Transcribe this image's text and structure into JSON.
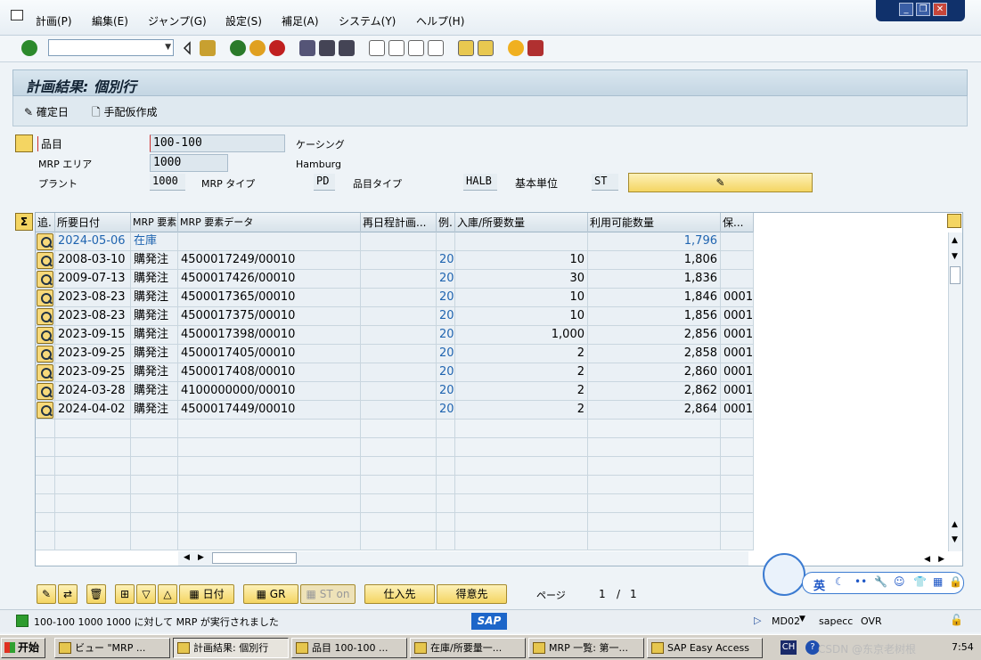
{
  "menubar": {
    "items": [
      "計画(P)",
      "編集(E)",
      "ジャンプ(G)",
      "設定(S)",
      "補足(A)",
      "システム(Y)",
      "ヘルプ(H)"
    ]
  },
  "toolbar": {
    "command_field_value": ""
  },
  "title": "計画結果: 個別行",
  "app_toolbar": {
    "firm_date": "確定日",
    "procurement": "手配仮作成"
  },
  "header": {
    "material_label": "品目",
    "material_value": "100-100",
    "material_desc": "ケーシング",
    "mrp_area_label": "MRP エリア",
    "mrp_area_value": "1000",
    "mrp_area_desc": "Hamburg",
    "plant_label": "プラント",
    "plant_value": "1000",
    "mrp_type_label": "MRP タイプ",
    "mrp_type_value": "PD",
    "material_type_label": "品目タイプ",
    "material_type_value": "HALB",
    "base_unit_label": "基本単位",
    "base_unit_value": "ST"
  },
  "grid": {
    "columns": [
      "追.",
      "所要日付",
      "MRP 要素",
      "MRP 要素データ",
      "再日程計画...",
      "例.",
      "入庫/所要数量",
      "利用可能数量",
      "保..."
    ],
    "rows": [
      {
        "date": "2024-05-06",
        "element": "在庫",
        "data": "",
        "reschedule": "",
        "exc": "",
        "qty": "",
        "avail": "1,796",
        "stor": "",
        "highlight": true
      },
      {
        "date": "2008-03-10",
        "element": "購発注",
        "data": "4500017249/00010",
        "reschedule": "",
        "exc": "20",
        "qty": "10",
        "avail": "1,806",
        "stor": "",
        "highlight": false
      },
      {
        "date": "2009-07-13",
        "element": "購発注",
        "data": "4500017426/00010",
        "reschedule": "",
        "exc": "20",
        "qty": "30",
        "avail": "1,836",
        "stor": "",
        "highlight": false
      },
      {
        "date": "2023-08-23",
        "element": "購発注",
        "data": "4500017365/00010",
        "reschedule": "",
        "exc": "20",
        "qty": "10",
        "avail": "1,846",
        "stor": "0001",
        "highlight": false
      },
      {
        "date": "2023-08-23",
        "element": "購発注",
        "data": "4500017375/00010",
        "reschedule": "",
        "exc": "20",
        "qty": "10",
        "avail": "1,856",
        "stor": "0001",
        "highlight": false
      },
      {
        "date": "2023-09-15",
        "element": "購発注",
        "data": "4500017398/00010",
        "reschedule": "",
        "exc": "20",
        "qty": "1,000",
        "avail": "2,856",
        "stor": "0001",
        "highlight": false
      },
      {
        "date": "2023-09-25",
        "element": "購発注",
        "data": "4500017405/00010",
        "reschedule": "",
        "exc": "20",
        "qty": "2",
        "avail": "2,858",
        "stor": "0001",
        "highlight": false
      },
      {
        "date": "2023-09-25",
        "element": "購発注",
        "data": "4500017408/00010",
        "reschedule": "",
        "exc": "20",
        "qty": "2",
        "avail": "2,860",
        "stor": "0001",
        "highlight": false
      },
      {
        "date": "2024-03-28",
        "element": "購発注",
        "data": "4100000000/00010",
        "reschedule": "",
        "exc": "20",
        "qty": "2",
        "avail": "2,862",
        "stor": "0001",
        "highlight": false
      },
      {
        "date": "2024-04-02",
        "element": "購発注",
        "data": "4500017449/00010",
        "reschedule": "",
        "exc": "20",
        "qty": "2",
        "avail": "2,864",
        "stor": "0001",
        "highlight": false
      }
    ]
  },
  "bottom": {
    "date_btn": "日付",
    "gr_btn": "GR",
    "st_on_btn": "ST on",
    "vendor_btn": "仕入先",
    "customer_btn": "得意先",
    "page_label": "ページ",
    "page_current": "1",
    "page_sep": "/",
    "page_total": "1"
  },
  "status": {
    "message": "100-100  1000  1000 に対して MRP が実行されました",
    "logo": "SAP",
    "transaction": "MD02",
    "server": "sapecc",
    "mode": "OVR"
  },
  "taskbar": {
    "start": "开始",
    "tasks": [
      "ビュー \"MRP ...",
      "計画結果: 個別行",
      "品目 100-100 ...",
      "在庫/所要量一...",
      "MRP 一覧: 第一...",
      "SAP Easy Access"
    ],
    "lang": "CH",
    "clock": "7:54",
    "watermark": "CSDN @东京老树根"
  },
  "ime": {
    "lang": "英"
  },
  "colors": {
    "accent_blue": "#1f64b0",
    "button_yellow": "#f4d562",
    "title_bg": "#c4d6e3"
  }
}
